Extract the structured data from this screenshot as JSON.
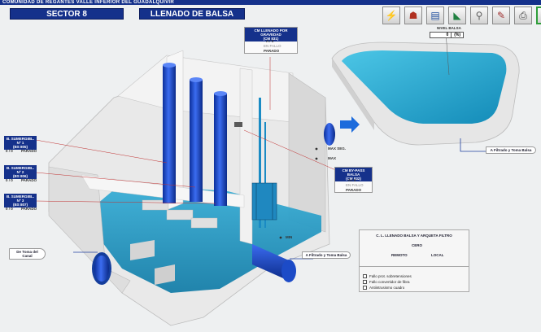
{
  "header": {
    "community": "COMUNIDAD DE REGANTES VALLE INFERIOR DEL GUADALQUIVIR",
    "sector": "SECTOR 8",
    "screen": "LLENADO DE BALSA"
  },
  "toolbar": {
    "buttons": [
      {
        "name": "alarm-bolt-icon",
        "glyph": "⚡",
        "color": "#e0a000"
      },
      {
        "name": "user-icon",
        "glyph": "☗",
        "color": "#b03020"
      },
      {
        "name": "meter-icon",
        "glyph": "▤",
        "color": "#2050a0"
      },
      {
        "name": "trend-icon",
        "glyph": "◣",
        "color": "#208040"
      },
      {
        "name": "search-icon",
        "glyph": "⚲",
        "color": "#606060"
      },
      {
        "name": "tools-icon",
        "glyph": "✎",
        "color": "#a03030"
      },
      {
        "name": "printer-icon",
        "glyph": "⎙",
        "color": "#404040"
      },
      {
        "name": "exit-icon",
        "glyph": "⊗",
        "color": "#c02030"
      }
    ]
  },
  "valves": {
    "gravity": {
      "title": "CM LLENADO POR GRAVEDAD",
      "code": "(CM 831)",
      "mode": "A / 0",
      "fault": "EN FALLO",
      "state": "PARADO"
    },
    "bypass": {
      "title": "CM BY-PASS BALSA",
      "code": "(CM 832)",
      "mode": "A / 0",
      "fault": "EN FALLO",
      "state": "PARADO"
    }
  },
  "pumps": [
    {
      "title": "B. SUMERGIBL. Nº 1",
      "code": "(BS 805)",
      "mode": "0 / 0",
      "state": "PARADO"
    },
    {
      "title": "B. SUMERGIBL. Nº 2",
      "code": "(BS 806)",
      "mode": "0 / 0",
      "state": "PARADO"
    },
    {
      "title": "B. SUMERGIBL. Nº 3",
      "code": "(BS 807)",
      "mode": "0 / 0",
      "state": "PARADO"
    }
  ],
  "reservoir": {
    "level_label": "NIVEL BALSA",
    "level_value": "0",
    "level_unit": "(%)"
  },
  "markers": {
    "max_seg": "MAX SEG.",
    "max": "MAX",
    "min": "MIN"
  },
  "tags": {
    "inlet": "De Toma del Canal",
    "outlet_tank": "A Filtrado y Toma Balsa",
    "outlet_reservoir": "A Filtrado y Toma Balsa"
  },
  "legend": {
    "title": "C. L. LLENADO BALSA Y ARQUETA FILTRO",
    "state": "CERO",
    "remote": "REMOTO",
    "local": "LOCAL",
    "checks": [
      "Fallo prot. sobretensiones",
      "Fallo convertidor de fibra",
      "Antiintrusismo cuadro"
    ]
  }
}
